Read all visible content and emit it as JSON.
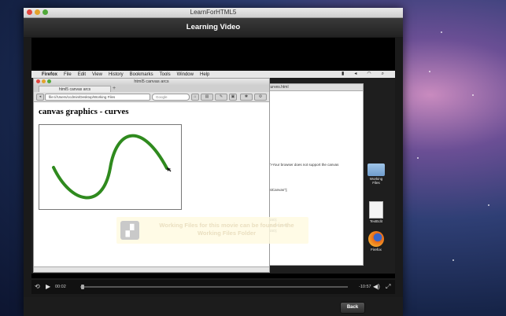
{
  "app": {
    "window_title": "LearnForHTML5",
    "header_title": "Learning Video"
  },
  "mac_menubar": {
    "apple": "",
    "items": [
      "Firefox",
      "File",
      "Edit",
      "View",
      "History",
      "Bookmarks",
      "Tools",
      "Window",
      "Help"
    ]
  },
  "firefox": {
    "window_title": "html5 canvas arcs",
    "tab_title": "html5 canvas arcs",
    "url": "file:///Users/ccdmin/Desktop/Working Files",
    "search_placeholder": "Google",
    "page_heading": "canvas graphics - curves"
  },
  "editor": {
    "title": "curves.html",
    "lines": [
      "00\">Your browser does not support the canvas",
      "\"testCanvas\");",
      ",0,150);",
      ",150,250,150);",
      ",0,150);"
    ]
  },
  "watermark": {
    "text": "Working Files for this movie can be found in the Working Files Folder"
  },
  "desktop_icons": [
    {
      "label": "Working Files",
      "kind": "folder"
    },
    {
      "label": "TextEdit",
      "kind": "doc"
    },
    {
      "label": "Firefox",
      "kind": "firefox"
    }
  ],
  "player": {
    "elapsed": "00:02",
    "remaining": "-10:57",
    "progress": 0.01,
    "back_label": "Back"
  },
  "colors": {
    "curve": "#2f8a1e",
    "accent_red": "#e2463f"
  }
}
